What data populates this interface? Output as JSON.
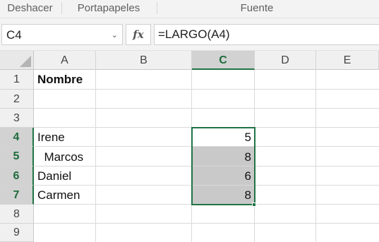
{
  "ribbon": {
    "groups": [
      "Deshacer",
      "Portapapeles",
      "Fuente"
    ]
  },
  "formula_bar": {
    "name_box": "C4",
    "fx_label": "fx",
    "formula": "=LARGO(A4)"
  },
  "columns": [
    "A",
    "B",
    "C",
    "D",
    "E"
  ],
  "rows": [
    "1",
    "2",
    "3",
    "4",
    "5",
    "6",
    "7",
    "8",
    "9"
  ],
  "selected_column": "C",
  "selected_rows": [
    "4",
    "5",
    "6",
    "7"
  ],
  "cells": {
    "a1": "Nombre",
    "a4": "Irene",
    "a5": "  Marcos",
    "a6": "Daniel",
    "a7": "Carmen",
    "c4": "5",
    "c5": "8",
    "c6": "6",
    "c7": "8"
  },
  "colors": {
    "accent": "#217346",
    "selection_fill": "#c9c9c9"
  }
}
